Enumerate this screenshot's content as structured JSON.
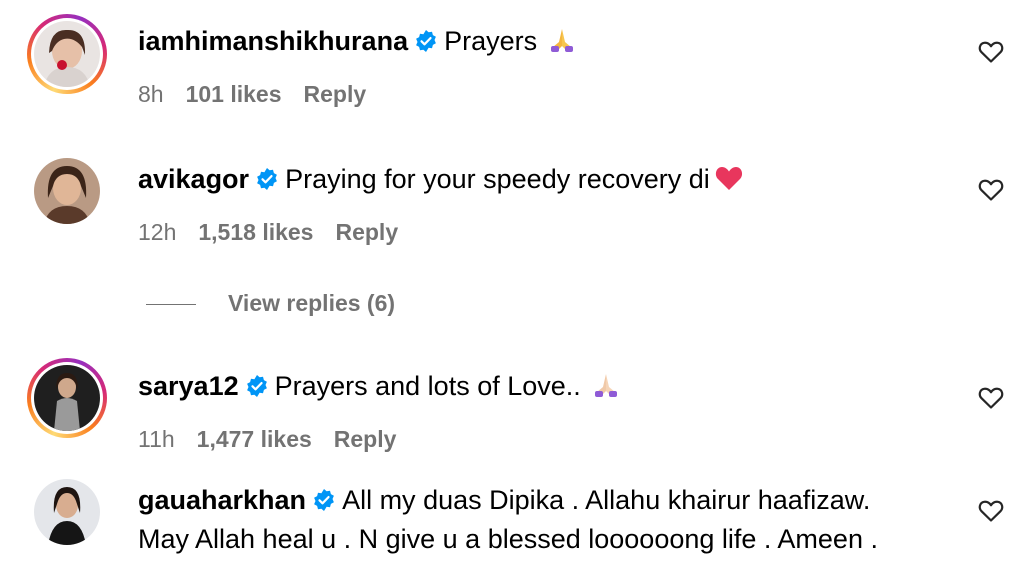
{
  "comments": [
    {
      "username": "iamhimanshikhurana",
      "text": "Prayers",
      "emoji": "folded-hands",
      "time": "8h",
      "likes": "101 likes",
      "reply": "Reply",
      "story_ring": true
    },
    {
      "username": "avikagor",
      "text": "Praying for your speedy recovery di",
      "emoji": "heart",
      "time": "12h",
      "likes": "1,518 likes",
      "reply": "Reply",
      "story_ring": false
    },
    {
      "username": "sarya12",
      "text": "Prayers and lots of Love..",
      "emoji": "folded-hands",
      "time": "11h",
      "likes": "1,477 likes",
      "reply": "Reply",
      "story_ring": true
    },
    {
      "username": "gauaharkhan",
      "text": "All my duas Dipika . Allahu khairur haafizaw.",
      "text_line2": "May Allah heal u . N give u a blessed loooooong life . Ameen .",
      "story_ring": false
    }
  ],
  "view_replies": "View replies (6)",
  "colors": {
    "verified": "#0095f6",
    "muted": "#737373",
    "heart_emoji": "#e8365d"
  }
}
